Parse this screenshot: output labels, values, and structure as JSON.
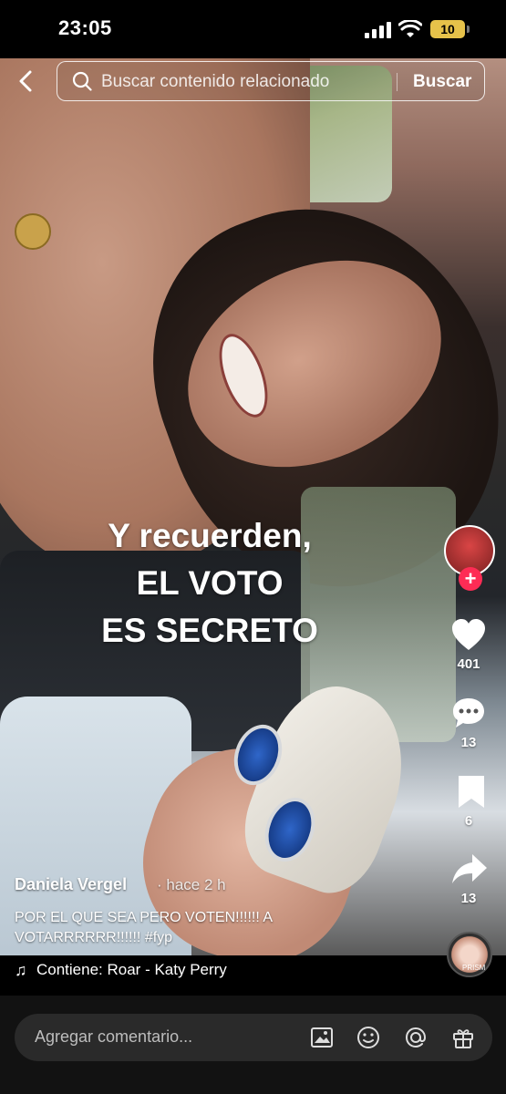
{
  "status_bar": {
    "time": "23:05",
    "battery": "10"
  },
  "search": {
    "placeholder": "Buscar contenido relacionado",
    "button": "Buscar"
  },
  "overlay": {
    "line1": "Y recuerden,",
    "line2": "EL VOTO",
    "line3": "ES SECRETO"
  },
  "actions": {
    "likes": "401",
    "comments": "13",
    "saves": "6",
    "shares": "13"
  },
  "post": {
    "author": "Daniela Vergel",
    "time_ago": "· hace 2 h",
    "description": "POR EL QUE SEA PERO VOTEN!!!!!! A VOTARRRRRR!!!!!! #fyp"
  },
  "music": {
    "icon": "♫",
    "text": "Contiene: Roar - Katy Perry",
    "disc_label": "PRISM"
  },
  "comment_bar": {
    "placeholder": "Agregar comentario..."
  },
  "icons": {
    "back": "chevron-left-icon",
    "search": "search-icon",
    "heart": "heart-icon",
    "comment": "comment-bubble-icon",
    "bookmark": "bookmark-icon",
    "share": "share-arrow-icon",
    "image": "image-icon",
    "emoji": "emoji-icon",
    "mention": "at-sign-icon",
    "gift": "gift-icon"
  },
  "colors": {
    "follow_accent": "#fe2c55",
    "battery": "#e6c24a"
  }
}
